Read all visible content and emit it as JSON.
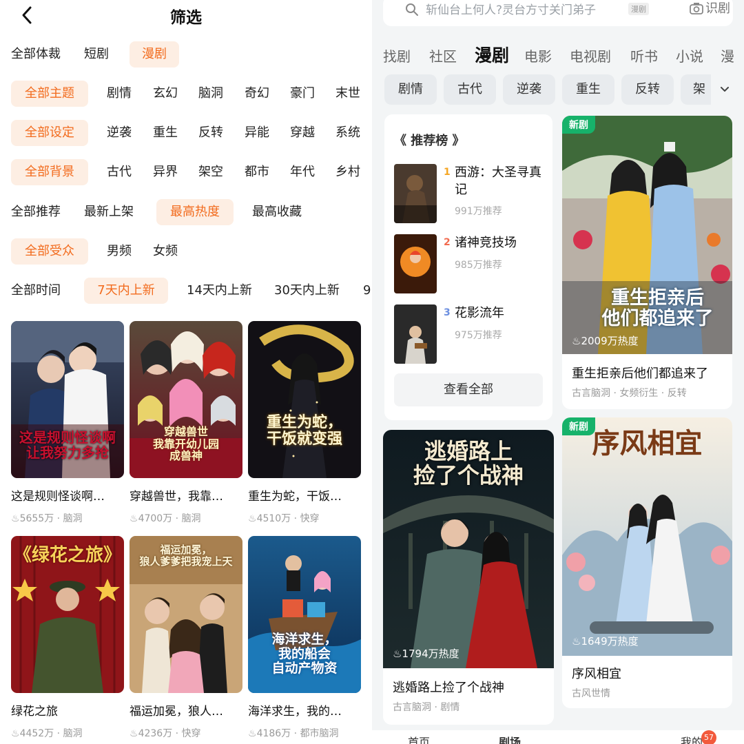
{
  "left": {
    "title": "筛选",
    "rows": [
      {
        "name": "form",
        "items": [
          "全部体裁",
          "短剧",
          "漫剧"
        ],
        "selected": 2
      },
      {
        "name": "theme",
        "items": [
          "全部主题",
          "剧情",
          "玄幻",
          "脑洞",
          "奇幻",
          "豪门",
          "末世"
        ],
        "selected": 0
      },
      {
        "name": "setting",
        "items": [
          "全部设定",
          "逆袭",
          "重生",
          "反转",
          "异能",
          "穿越",
          "系统"
        ],
        "selected": 0
      },
      {
        "name": "background",
        "items": [
          "全部背景",
          "古代",
          "异界",
          "架空",
          "都市",
          "年代",
          "乡村"
        ],
        "selected": 0
      },
      {
        "name": "recommend",
        "items": [
          "全部推荐",
          "最新上架",
          "最高热度",
          "最高收藏"
        ],
        "selected": 2
      },
      {
        "name": "audience",
        "items": [
          "全部受众",
          "男频",
          "女频"
        ],
        "selected": 0
      },
      {
        "name": "time",
        "items": [
          "全部时间",
          "7天内上新",
          "14天内上新",
          "30天内上新",
          "9"
        ],
        "selected": 1
      }
    ],
    "cards": [
      {
        "title": "这是规则怪谈啊…",
        "heat": "5655万",
        "tag": "脑洞",
        "cover_text": "这是规则怪谈啊\n让我努力多抢",
        "accent": "#c8102e"
      },
      {
        "title": "穿越兽世，我靠…",
        "heat": "4700万",
        "tag": "脑洞",
        "cover_text": "穿越兽世\n我靠开幼儿园\n成兽神",
        "accent": "#f5e6a8"
      },
      {
        "title": "重生为蛇，干饭…",
        "heat": "4510万",
        "tag": "快穿",
        "cover_text": "重生为蛇，\n干饭就变强",
        "accent": "#f7d14a"
      },
      {
        "title": "绿花之旅",
        "heat": "4452万",
        "tag": "脑洞",
        "cover_text": "《绿花之旅》",
        "accent": "#f7d14a"
      },
      {
        "title": "福运加冕，狼人…",
        "heat": "4236万",
        "tag": "快穿",
        "cover_text": "福运加冕，\n狼人爹爹把我宠上天",
        "accent": "#f3e2a6"
      },
      {
        "title": "海洋求生，我的…",
        "heat": "4186万",
        "tag": "都市脑洞",
        "cover_text": "海洋求生，\n我的船会\n自动产物资",
        "accent": "#ffffff"
      }
    ],
    "meta_separator": "·"
  },
  "right": {
    "search": {
      "placeholder": "斩仙台上何人?灵台方寸关门弟子",
      "tag": "漫剧",
      "scan_label": "识剧"
    },
    "tabs": [
      "找剧",
      "社区",
      "漫剧",
      "电影",
      "电视剧",
      "听书",
      "小说",
      "漫"
    ],
    "active_tab": 2,
    "genres": [
      "剧情",
      "古代",
      "逆袭",
      "重生",
      "反转",
      "架"
    ],
    "ranking": {
      "title": "《 推荐榜 》",
      "items": [
        {
          "rank": "1",
          "name": "西游：大圣寻真记",
          "count": "991万推荐",
          "color": "#f5a623"
        },
        {
          "rank": "2",
          "name": "诸神竞技场",
          "count": "985万推荐",
          "color": "#f26b4f"
        },
        {
          "rank": "3",
          "name": "花影流年",
          "count": "975万推荐",
          "color": "#6c8fe0"
        }
      ],
      "view_all": "查看全部"
    },
    "feed": [
      {
        "badge": "新剧",
        "title": "重生拒亲后他们都追来了",
        "tags": "古言脑洞 · 女频衍生 · 反转",
        "heat": "2009万热度",
        "cover_text": "重生拒亲后\n他们都追来了"
      },
      {
        "badge": "",
        "title": "逃婚路上捡了个战神",
        "tags": "古言脑洞 · 剧情",
        "heat": "1794万热度",
        "cover_text": "逃婚路上\n捡了个战神"
      },
      {
        "badge": "新剧",
        "title": "序风相宜",
        "tags": "古风世情",
        "heat": "1649万热度",
        "cover_text": "序风相宜"
      }
    ],
    "bottom_nav": {
      "home": "首页",
      "drama": "剧场",
      "mine": "我的",
      "badge": "57"
    }
  }
}
